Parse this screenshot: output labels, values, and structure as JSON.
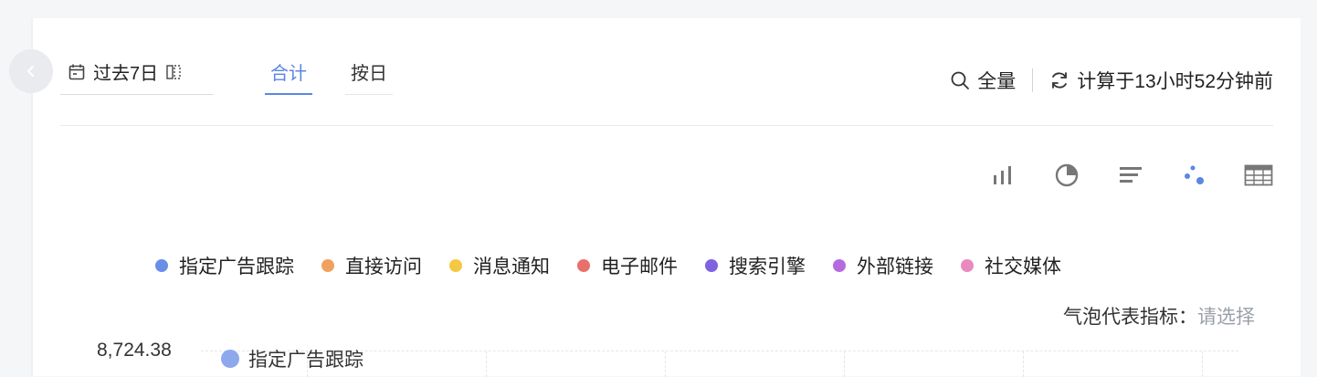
{
  "date_picker": {
    "label": "过去7日",
    "icon": "calendar-icon"
  },
  "tabs": [
    {
      "label": "合计",
      "active": true
    },
    {
      "label": "按日",
      "active": false
    }
  ],
  "toolbar": {
    "scope_label": "全量",
    "scope_icon": "search-icon",
    "refresh_label": "计算于13小时52分钟前",
    "refresh_icon": "refresh-icon"
  },
  "chart_types": [
    "bar-chart-icon",
    "pie-chart-icon",
    "bar-list-icon",
    "bubble-chart-icon",
    "table-icon"
  ],
  "active_chart_type": "bubble-chart-icon",
  "legend": [
    {
      "label": "指定广告跟踪",
      "color": "#6a8ee8"
    },
    {
      "label": "直接访问",
      "color": "#f0a15e"
    },
    {
      "label": "消息通知",
      "color": "#f5c842"
    },
    {
      "label": "电子邮件",
      "color": "#e8706a"
    },
    {
      "label": "搜索引擎",
      "color": "#7e62e0"
    },
    {
      "label": "外部链接",
      "color": "#b56be0"
    },
    {
      "label": "社交媒体",
      "color": "#e989bf"
    }
  ],
  "bubble_metric": {
    "label": "气泡代表指标：",
    "placeholder": "请选择"
  },
  "y_axis_top": "8,724.38",
  "series_tag": "指定广告跟踪",
  "colors": {
    "accent": "#5b86e5"
  }
}
